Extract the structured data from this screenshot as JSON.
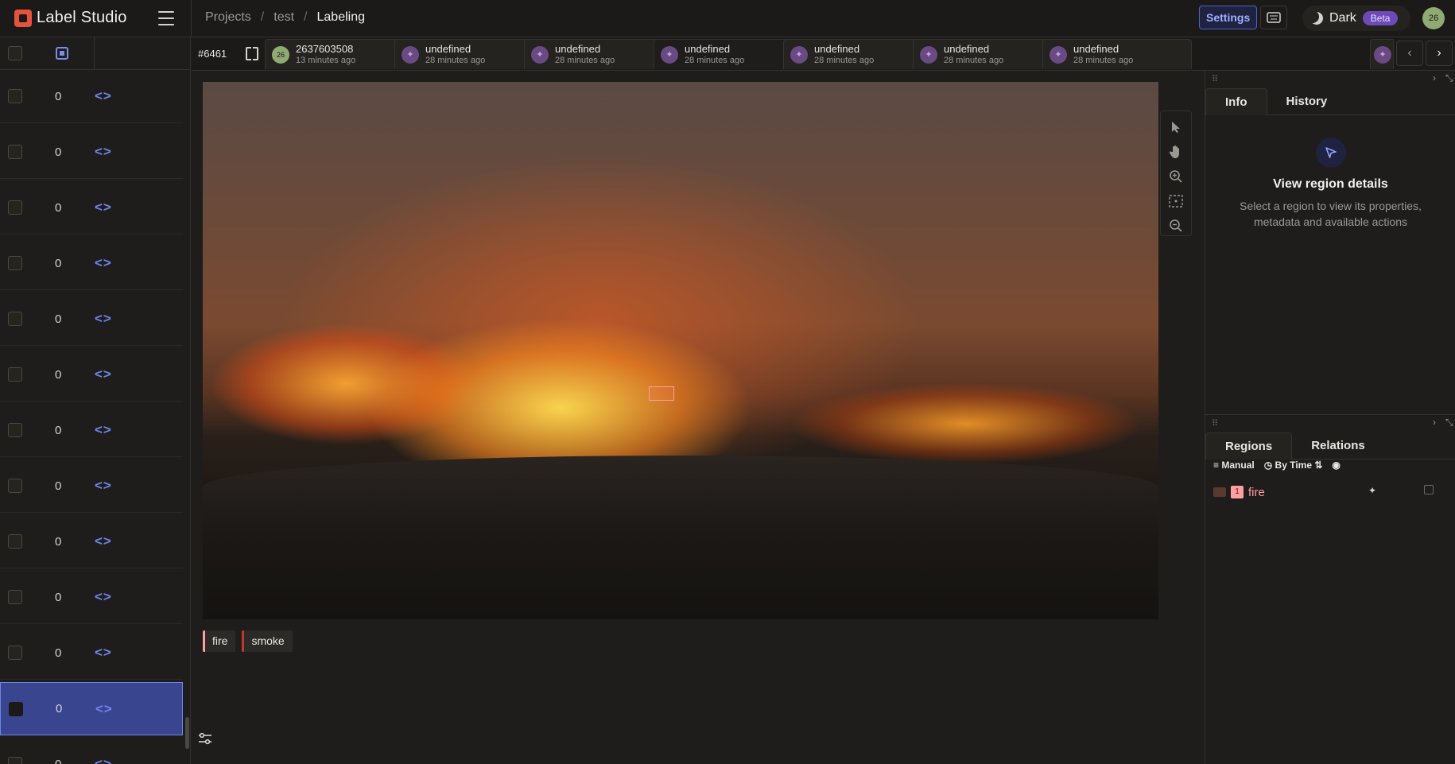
{
  "app": {
    "name": "Label Studio"
  },
  "breadcrumb": [
    "Projects",
    "test",
    "Labeling"
  ],
  "topbar": {
    "settings_label": "Settings",
    "theme_label": "Dark",
    "beta_label": "Beta",
    "user_initials": "26"
  },
  "task": {
    "id": "#6461"
  },
  "annotation_tabs": [
    {
      "title": "2637603508",
      "time": "13 minutes ago",
      "avatar": "26"
    },
    {
      "title": "undefined",
      "time": "28 minutes ago"
    },
    {
      "title": "undefined",
      "time": "28 minutes ago"
    },
    {
      "title": "undefined",
      "time": "28 minutes ago"
    },
    {
      "title": "undefined",
      "time": "28 minutes ago"
    },
    {
      "title": "undefined",
      "time": "28 minutes ago"
    },
    {
      "title": "undefined",
      "time": "28 minutes ago"
    }
  ],
  "task_list": {
    "rows": [
      "0",
      "0",
      "0",
      "0",
      "0",
      "0",
      "0",
      "0",
      "0",
      "0",
      "0",
      "0",
      "0"
    ],
    "code_glyph": "<>",
    "selected_index": 11
  },
  "labels": [
    "fire",
    "smoke"
  ],
  "side_panel": {
    "tabs": [
      "Info",
      "History"
    ],
    "empty_title": "View region details",
    "empty_desc": "Select a region to view its properties, metadata and available actions"
  },
  "regions_panel": {
    "tabs": [
      "Regions",
      "Relations"
    ],
    "order_manual": "Manual",
    "order_time": "By Time",
    "items": [
      {
        "index": "1",
        "label": "fire"
      }
    ]
  },
  "colors": {
    "accent": "#6f84ea",
    "fire_label": "#ff9f9f",
    "smoke_label": "#c0392b"
  }
}
